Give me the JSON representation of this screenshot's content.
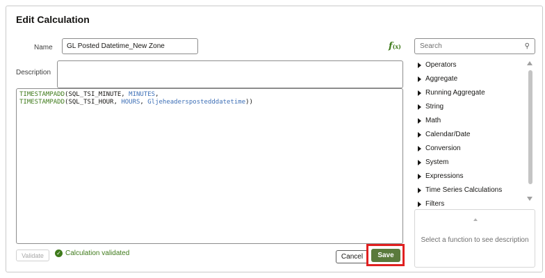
{
  "dialog": {
    "title": "Edit Calculation"
  },
  "form": {
    "name_label": "Name",
    "name_value": "GL Posted Datetime_New Zone",
    "description_label": "Description",
    "description_value": "",
    "fx_icon": "function-icon"
  },
  "editor": {
    "line1": {
      "fn": "TIMESTAMPADD",
      "open": "(SQL_TSI_MINUTE, ",
      "kw": "MINUTES",
      "close": ","
    },
    "line2": {
      "fn": "TIMESTAMPADD",
      "open": "(SQL_TSI_HOUR, ",
      "kw1": "HOURS",
      "sep": ", ",
      "kw2": "Gljeheaderspostedddatetime",
      "close": "))"
    }
  },
  "footer": {
    "validate_label": "Validate",
    "validated_text": "Calculation validated",
    "cancel_label": "Cancel",
    "save_label": "Save",
    "highlight_color": "#e02020",
    "save_color": "#5a7a3c"
  },
  "function_panel": {
    "search_placeholder": "Search",
    "items": [
      {
        "label": "Operators"
      },
      {
        "label": "Aggregate"
      },
      {
        "label": "Running Aggregate"
      },
      {
        "label": "String"
      },
      {
        "label": "Math"
      },
      {
        "label": "Calendar/Date"
      },
      {
        "label": "Conversion"
      },
      {
        "label": "System"
      },
      {
        "label": "Expressions"
      },
      {
        "label": "Time Series Calculations"
      },
      {
        "label": "Filters"
      }
    ],
    "description_hint": "Select a function to see description"
  }
}
